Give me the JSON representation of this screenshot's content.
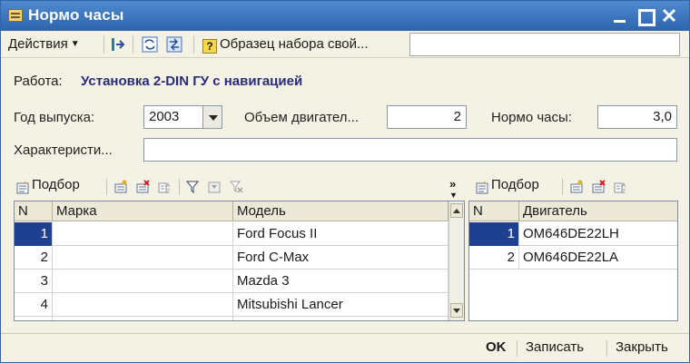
{
  "window": {
    "title": "Нормо часы"
  },
  "toolbar": {
    "actions_label": "Действия",
    "help_label": "Образец набора свой...",
    "search_value": ""
  },
  "form": {
    "work_label": "Работа:",
    "work_value": "Установка 2-DIN ГУ с навигацией",
    "year_label": "Год выпуска:",
    "year_value": "2003",
    "engine_volume_label": "Объем двигател...",
    "engine_volume_value": "2",
    "norm_hours_label": "Нормо часы:",
    "norm_hours_value": "3,0",
    "characteristics_label": "Характеристи...",
    "characteristics_value": ""
  },
  "left_grid": {
    "toolbar_label": "Подбор",
    "columns": [
      "N",
      "Марка",
      "Модель"
    ],
    "rows": [
      {
        "n": "1",
        "brand": "",
        "model": "Ford Focus II"
      },
      {
        "n": "2",
        "brand": "",
        "model": "Ford C-Max"
      },
      {
        "n": "3",
        "brand": "",
        "model": "Mazda 3"
      },
      {
        "n": "4",
        "brand": "",
        "model": "Mitsubishi Lancer"
      }
    ]
  },
  "right_grid": {
    "toolbar_label": "Подбор",
    "columns": [
      "N",
      "Двигатель"
    ],
    "rows": [
      {
        "n": "1",
        "engine": "OM646DE22LH"
      },
      {
        "n": "2",
        "engine": "OM646DE22LA"
      }
    ]
  },
  "footer": {
    "ok_label": "OK",
    "save_label": "Записать",
    "close_label": "Закрыть"
  }
}
